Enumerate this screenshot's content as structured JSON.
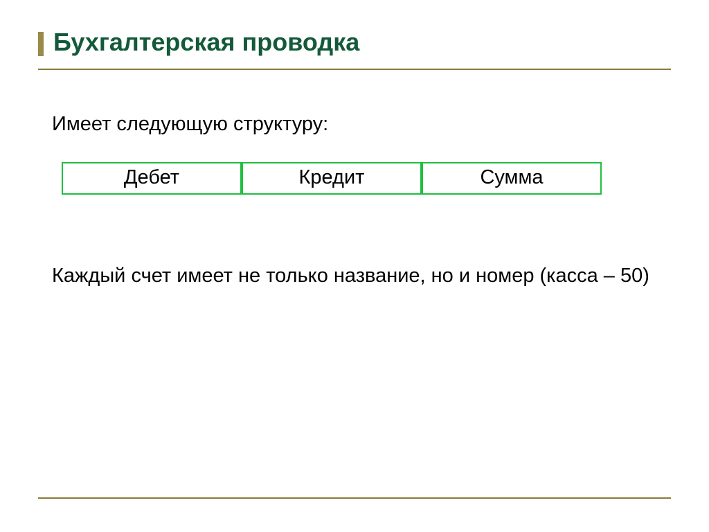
{
  "title": "Бухгалтерская проводка",
  "intro": "Имеет следующую структуру:",
  "cells": {
    "c1": "Дебет",
    "c2": "Кредит",
    "c3": "Сумма"
  },
  "note": "Каждый счет имеет не только название, но  и номер (касса – 50)"
}
